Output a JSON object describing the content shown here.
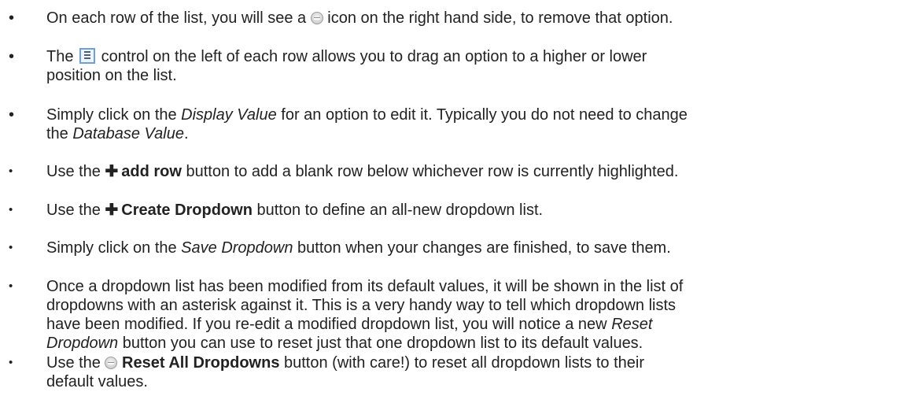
{
  "bullets": [
    {
      "segments": [
        {
          "t": "On each row of the list, you will see a "
        },
        {
          "icon": "remove-icon"
        },
        {
          "t": " icon on the right hand side, to remove that option."
        }
      ]
    },
    {
      "lines": [
        [
          {
            "t": "The "
          },
          {
            "icon": "drag-icon"
          },
          {
            "t": " control on the left of each row allows you to drag an option to a higher or lower"
          }
        ],
        [
          {
            "t": "position on the list."
          }
        ]
      ]
    },
    {
      "lines": [
        [
          {
            "t": "Simply click on the "
          },
          {
            "t": "Display Value",
            "style": "em"
          },
          {
            "t": " for an option to edit it. Typically you do not need to change"
          }
        ],
        [
          {
            "t": "the "
          },
          {
            "t": "Database Value",
            "style": "em"
          },
          {
            "t": "."
          }
        ]
      ]
    },
    {
      "segments": [
        {
          "t": "Use the "
        },
        {
          "icon": "plus-icon",
          "t": "✚"
        },
        {
          "t": "add row",
          "style": "strong"
        },
        {
          "t": " button to add a blank row below whichever row is currently highlighted."
        }
      ]
    },
    {
      "segments": [
        {
          "t": "Use the "
        },
        {
          "icon": "plus-icon",
          "t": "✚"
        },
        {
          "t": "Create Dropdown",
          "style": "strong"
        },
        {
          "t": " button to define an all-new dropdown list."
        }
      ]
    },
    {
      "segments": [
        {
          "t": "Simply click on the "
        },
        {
          "t": "Save Dropdown",
          "style": "em"
        },
        {
          "t": " button when your changes are finished, to save them."
        }
      ]
    },
    {
      "lines": [
        [
          {
            "t": "Once a dropdown list has been modified from its default values, it will be shown in the list of"
          }
        ],
        [
          {
            "t": "dropdowns with an asterisk against it. This is a very handy way to tell which dropdown lists"
          }
        ],
        [
          {
            "t": "have been modified. If you re-edit a modified dropdown list, you will notice a new "
          },
          {
            "t": "Reset",
            "style": "em"
          }
        ],
        [
          {
            "t": "Dropdown",
            "style": "em"
          },
          {
            "t": " button you can use to reset just that one dropdown list to its default values."
          }
        ]
      ]
    },
    {
      "lines": [
        [
          {
            "t": "Use the "
          },
          {
            "icon": "remove-icon"
          },
          {
            "t": " "
          },
          {
            "t": "Reset All Dropdowns",
            "style": "strong"
          },
          {
            "t": " button (with care!) to reset all dropdown lists to their"
          }
        ],
        [
          {
            "t": "default values."
          }
        ]
      ]
    }
  ],
  "bullet_char": "•"
}
